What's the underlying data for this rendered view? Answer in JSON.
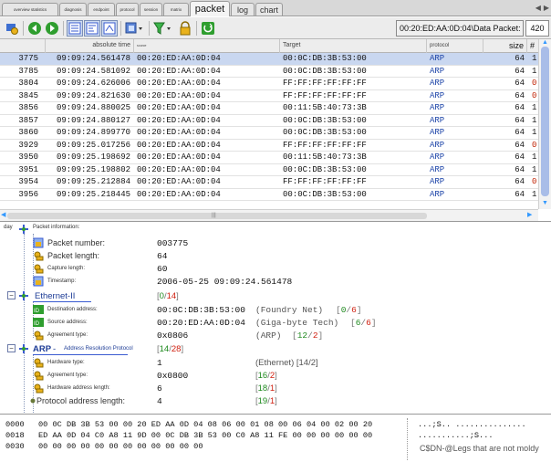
{
  "tabs": [
    {
      "label": "overview statistics",
      "size": "small"
    },
    {
      "label": "diagnosis",
      "size": "small"
    },
    {
      "label": "endpoint",
      "size": "small"
    },
    {
      "label": "protocol",
      "size": "small"
    },
    {
      "label": "session",
      "size": "small"
    },
    {
      "label": "matrix",
      "size": "small"
    },
    {
      "label": "packet",
      "size": "active"
    },
    {
      "label": "log",
      "size": "med"
    },
    {
      "label": "chart",
      "size": "med"
    }
  ],
  "toolbar": {
    "address": "00:20:ED:AA:0D:04\\Data Packet:",
    "count": "420"
  },
  "table": {
    "headers": {
      "num": "",
      "time": "absolute time",
      "src": "source",
      "dst": "Target",
      "proto": "protocol",
      "size": "size",
      "flag": "#"
    },
    "rows": [
      {
        "num": "3775",
        "time": "09:09:24.561478",
        "src": "00:20:ED:AA:0D:04",
        "dst": "00:0C:DB:3B:53:00",
        "proto": "ARP",
        "size": "64",
        "flag": "1"
      },
      {
        "num": "3785",
        "time": "09:09:24.581092",
        "src": "00:20:ED:AA:0D:04",
        "dst": "00:0C:DB:3B:53:00",
        "proto": "ARP",
        "size": "64",
        "flag": "1"
      },
      {
        "num": "3804",
        "time": "09:09:24.626006",
        "src": "00:20:ED:AA:0D:04",
        "dst": "FF:FF:FF:FF:FF:FF",
        "proto": "ARP",
        "size": "64",
        "flag": "0"
      },
      {
        "num": "3845",
        "time": "09:09:24.821630",
        "src": "00:20:ED:AA:0D:04",
        "dst": "FF:FF:FF:FF:FF:FF",
        "proto": "ARP",
        "size": "64",
        "flag": "0"
      },
      {
        "num": "3856",
        "time": "09:09:24.880025",
        "src": "00:20:ED:AA:0D:04",
        "dst": "00:11:5B:40:73:3B",
        "proto": "ARP",
        "size": "64",
        "flag": "1"
      },
      {
        "num": "3857",
        "time": "09:09:24.880127",
        "src": "00:20:ED:AA:0D:04",
        "dst": "00:0C:DB:3B:53:00",
        "proto": "ARP",
        "size": "64",
        "flag": "1"
      },
      {
        "num": "3860",
        "time": "09:09:24.899770",
        "src": "00:20:ED:AA:0D:04",
        "dst": "00:0C:DB:3B:53:00",
        "proto": "ARP",
        "size": "64",
        "flag": "1"
      },
      {
        "num": "3929",
        "time": "09:09:25.017256",
        "src": "00:20:ED:AA:0D:04",
        "dst": "FF:FF:FF:FF:FF:FF",
        "proto": "ARP",
        "size": "64",
        "flag": "0"
      },
      {
        "num": "3950",
        "time": "09:09:25.198692",
        "src": "00:20:ED:AA:0D:04",
        "dst": "00:11:5B:40:73:3B",
        "proto": "ARP",
        "size": "64",
        "flag": "1"
      },
      {
        "num": "3951",
        "time": "09:09:25.198802",
        "src": "00:20:ED:AA:0D:04",
        "dst": "00:0C:DB:3B:53:00",
        "proto": "ARP",
        "size": "64",
        "flag": "1"
      },
      {
        "num": "3954",
        "time": "09:09:25.212884",
        "src": "00:20:ED:AA:0D:04",
        "dst": "FF:FF:FF:FF:FF:FF",
        "proto": "ARP",
        "size": "64",
        "flag": "0"
      },
      {
        "num": "3956",
        "time": "09:09:25.218445",
        "src": "00:20:ED:AA:0D:04",
        "dst": "00:0C:DB:3B:53:00",
        "proto": "ARP",
        "size": "64",
        "flag": "1"
      }
    ]
  },
  "tree": {
    "root_prefix": "day",
    "root_label": "Packet information:",
    "packet_number_label": "Packet number:",
    "packet_number": "003775",
    "packet_length_label": "Packet length:",
    "packet_length": "64",
    "capture_length_label": "Capture length:",
    "capture_length": "60",
    "timestamp_label": "Timestamp:",
    "timestamp": "2006-05-25 09:09:24.561478",
    "eth_label": "Ethernet-II",
    "eth_range_a": "0",
    "eth_range_b": "14",
    "dst_label": "Destination address:",
    "dst_value": "00:0C:DB:3B:53:00",
    "dst_vendor": "(Foundry Net)",
    "dst_range_a": "0",
    "dst_range_b": "6",
    "src_label": "Source address:",
    "src_value": "00:20:ED:AA:0D:04",
    "src_vendor": "(Giga-byte Tech)",
    "src_range_a": "6",
    "src_range_b": "6",
    "agreement_label": "Agreement type:",
    "agreement_value": "0x0806",
    "agreement_desc": "(ARP)",
    "agreement_range_a": "12",
    "agreement_range_b": "2",
    "arp_label": "ARP",
    "arp_dash": "-",
    "arp_full": "Address Resolution Protocol",
    "arp_range_a": "14",
    "arp_range_b": "28",
    "hw_type_label": "Hardware type:",
    "hw_type_value": "1",
    "hw_type_desc": "(Ethernet) [14/2]",
    "ag_type_label": "Agreement type:",
    "ag_type_value": "0x0800",
    "ag_type_range_a": "16",
    "ag_type_range_b": "2",
    "hw_len_label": "Hardware address length:",
    "hw_len_value": "6",
    "hw_len_range_a": "18",
    "hw_len_range_b": "1",
    "proto_len_label": "Protocol address length:",
    "proto_len_value": "4",
    "proto_len_range_a": "19",
    "proto_len_range_b": "1"
  },
  "hex": {
    "rows": [
      {
        "offset": "0000",
        "bytes": "00 0C DB 3B 53 00 00 20 ED AA 0D 04 08 06 00 01 08 00 06 04 00 02 00 20",
        "ascii": "...;S.. ..............."
      },
      {
        "offset": "0018",
        "bytes": "ED AA 0D 04 C0 A8 11 9D 00 0C DB 3B 53 00 C0 A8 11 FE 00 00 00 00 00 00",
        "ascii": "...........;S..."
      },
      {
        "offset": "0030",
        "bytes": "00 00 00 00 00 00 00 00 00 00 00 00",
        "ascii": ""
      }
    ],
    "watermark": "C$DN-@Legs that are not moldy"
  },
  "colors": {
    "selection": "#c9d7f0",
    "protocol": "#1d44a8",
    "range_green": "#1f8a1f",
    "range_red": "#d02010"
  }
}
